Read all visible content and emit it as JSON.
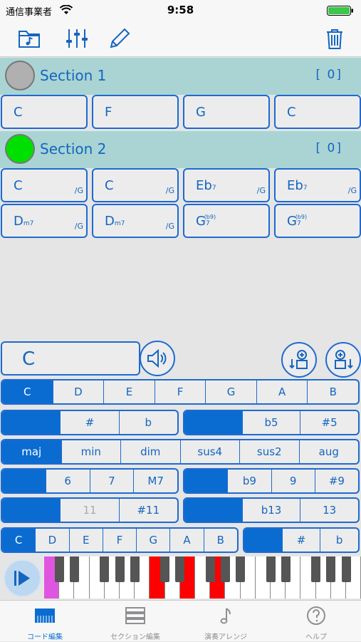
{
  "status_bar": {
    "carrier": "通信事業者",
    "time": "9:58"
  },
  "toolbar": {
    "icons": [
      "music-folder-icon",
      "sliders-icon",
      "pencil-icon",
      "trash-icon"
    ]
  },
  "sections": [
    {
      "title": "Section 1",
      "count": "[  0]",
      "color": "#b0b0b0",
      "chords": [
        {
          "root": "C",
          "qual": "",
          "tens": "",
          "bass": ""
        },
        {
          "root": "F",
          "qual": "",
          "tens": "",
          "bass": ""
        },
        {
          "root": "G",
          "qual": "",
          "tens": "",
          "bass": ""
        },
        {
          "root": "C",
          "qual": "",
          "tens": "",
          "bass": ""
        }
      ]
    },
    {
      "title": "Section 2",
      "count": "[  0]",
      "color": "#00e000",
      "chords": [
        {
          "root": "C",
          "qual": "",
          "tens": "",
          "bass": "/G"
        },
        {
          "root": "C",
          "qual": "",
          "tens": "",
          "bass": "/G"
        },
        {
          "root": "Eb",
          "qual": "7",
          "tens": "",
          "bass": "/G"
        },
        {
          "root": "Eb",
          "qual": "7",
          "tens": "",
          "bass": "/G"
        },
        {
          "root": "D",
          "qual": "m7",
          "tens": "",
          "bass": "/G"
        },
        {
          "root": "D",
          "qual": "m7",
          "tens": "",
          "bass": "/G"
        },
        {
          "root": "G",
          "qual": "7",
          "tens": "(b9)",
          "bass": ""
        },
        {
          "root": "G",
          "qual": "7",
          "tens": "(b9)",
          "bass": ""
        }
      ]
    }
  ],
  "editor": {
    "current_chord": "C",
    "root_row": [
      "C",
      "D",
      "E",
      "F",
      "G",
      "A",
      "B"
    ],
    "root_selected": 0,
    "accidental_row": [
      "",
      "#",
      "b"
    ],
    "fifth_row": [
      "",
      "b5",
      "#5"
    ],
    "quality_row": [
      "maj",
      "min",
      "dim",
      "sus4",
      "sus2",
      "aug"
    ],
    "quality_selected": 0,
    "seventh_row": [
      "",
      "6",
      "7",
      "M7"
    ],
    "ninth_row": [
      "",
      "b9",
      "9",
      "#9"
    ],
    "eleventh_row": [
      "",
      "11",
      "#11"
    ],
    "thirteenth_row": [
      "",
      "b13",
      "13"
    ],
    "bass_row": [
      "C",
      "D",
      "E",
      "F",
      "G",
      "A",
      "B"
    ],
    "bass_selected": 0,
    "bass_acc_row": [
      "",
      "#",
      "b"
    ]
  },
  "colors": {
    "accent": "#0a6cd1",
    "highlight_red": "#ff0000",
    "highlight_magenta": "#e055e0"
  },
  "tabs": [
    {
      "label": "コード編集",
      "icon": "keyboard-icon"
    },
    {
      "label": "セクション編集",
      "icon": "list-icon"
    },
    {
      "label": "演奏アレンジ",
      "icon": "music-note-icon"
    },
    {
      "label": "ヘルプ",
      "icon": "help-icon"
    }
  ]
}
